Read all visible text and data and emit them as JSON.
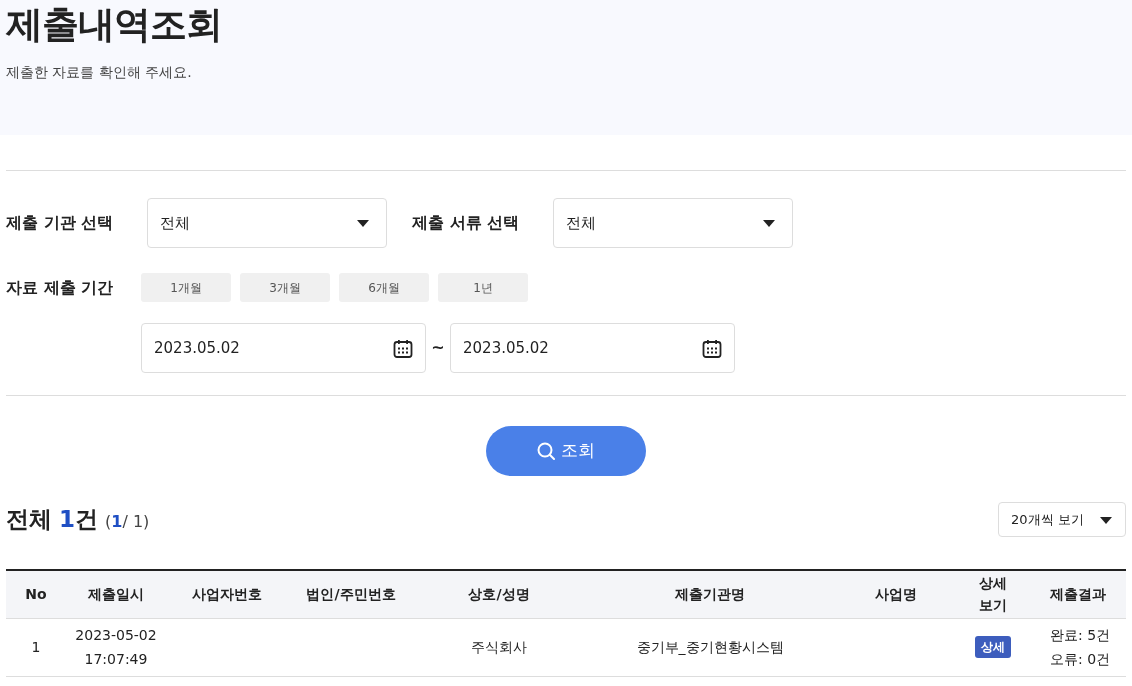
{
  "header": {
    "title": "제출내역조회",
    "subtitle": "제출한 자료를 확인해 주세요."
  },
  "filters": {
    "agency": {
      "label": "제출 기관 선택",
      "value": "전체"
    },
    "document": {
      "label": "제출 서류 선택",
      "value": "전체"
    },
    "period": {
      "label": "자료 제출 기간",
      "presets": [
        {
          "label": "1개월",
          "selected": false
        },
        {
          "label": "3개월",
          "selected": false
        },
        {
          "label": "6개월",
          "selected": false
        },
        {
          "label": "1년",
          "selected": false
        }
      ],
      "start": "2023.05.02",
      "separator": "~",
      "end": "2023.05.02"
    },
    "search_button": "조회"
  },
  "summary": {
    "prefix": "전체",
    "count": "1",
    "suffix": "건",
    "page_open": "(",
    "page_current": "1",
    "page_rest": "/ 1)",
    "page_size": "20개씩 보기"
  },
  "table": {
    "columns": [
      "No",
      "제출일시",
      "사업자번호",
      "법인/주민번호",
      "상호/성명",
      "제출기관명",
      "사업명",
      "상세 보기",
      "제출결과"
    ],
    "rows": [
      {
        "no": "1",
        "submitted_at": "2023-05-02 17:07:49",
        "company": "주식회사",
        "agency": "중기부_중기현황시스템",
        "detail_button": "상세",
        "result": [
          "완료: 5건",
          "오류: 0건"
        ]
      }
    ]
  }
}
